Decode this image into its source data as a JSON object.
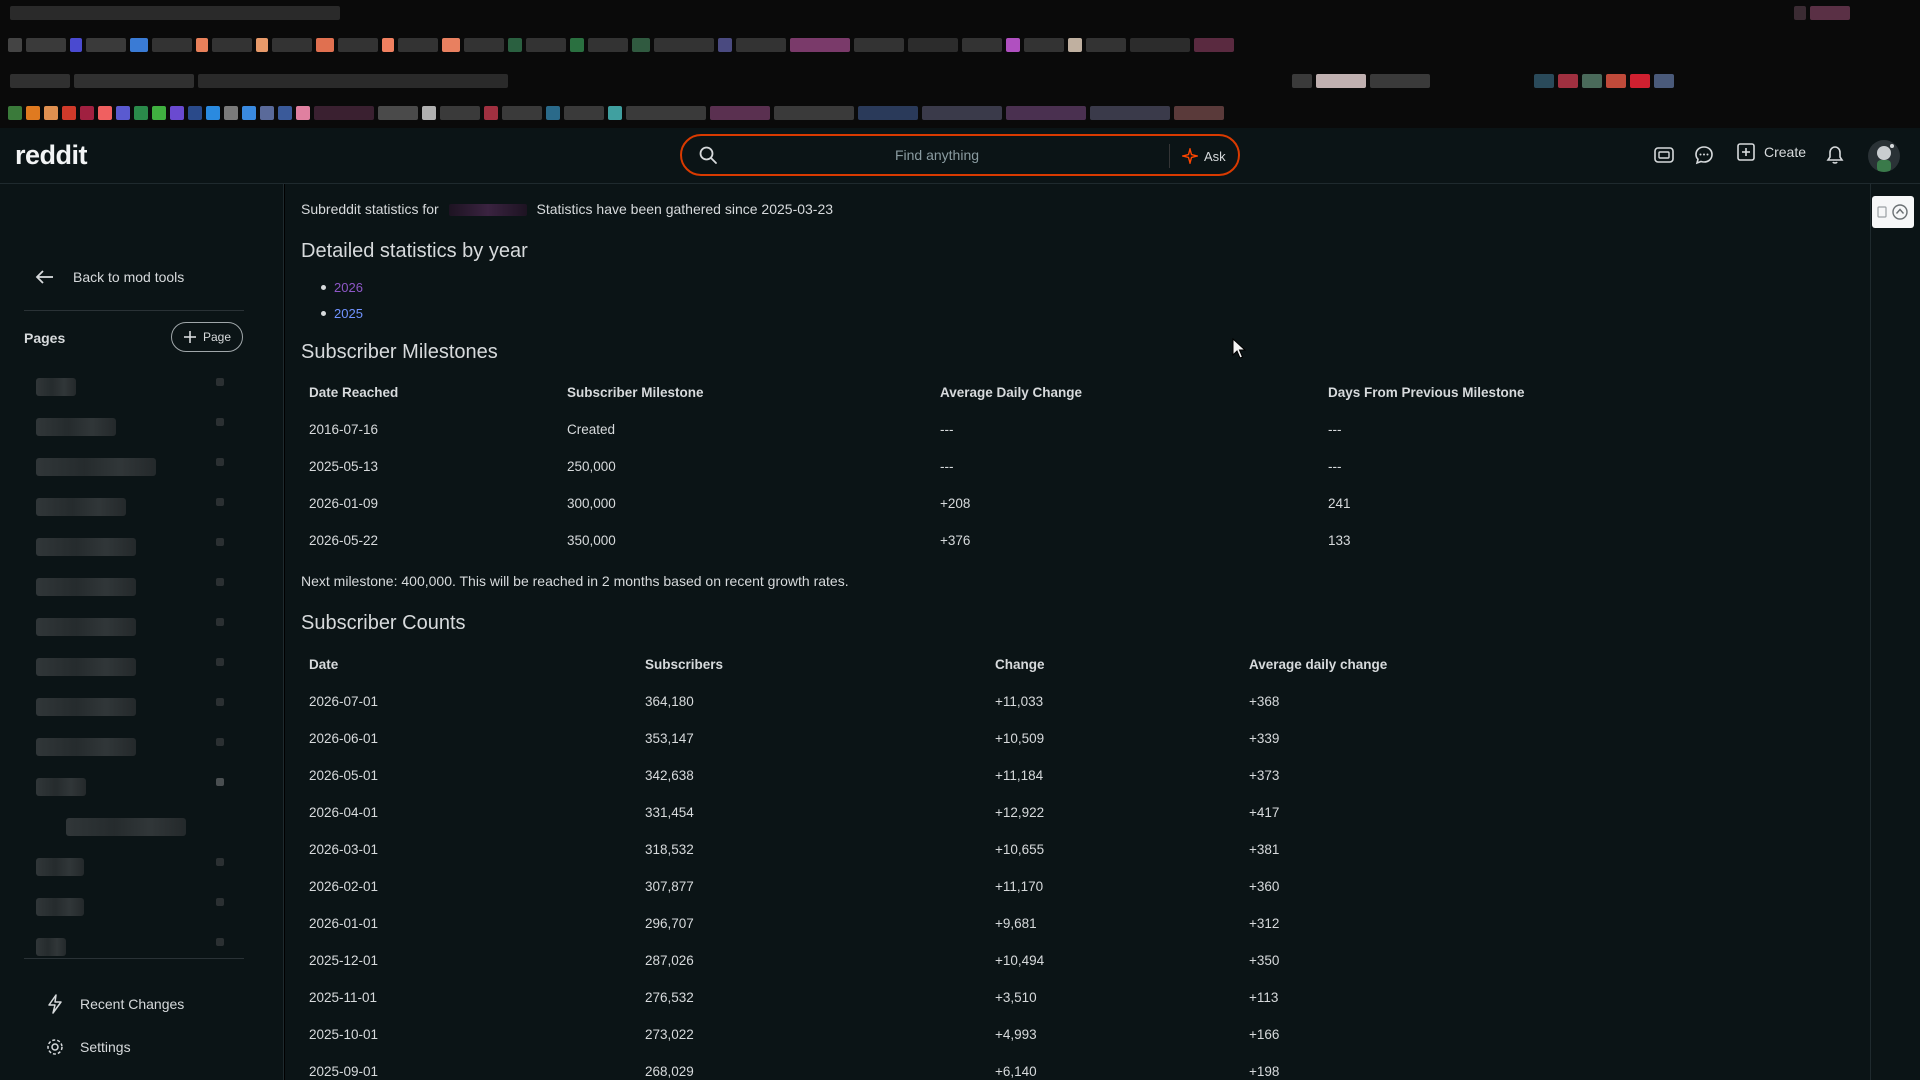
{
  "header": {
    "logo": "reddit",
    "search_placeholder": "Find anything",
    "ask_label": "Ask",
    "create_label": "Create"
  },
  "sidebar": {
    "back_label": "Back to mod tools",
    "pages_label": "Pages",
    "add_page_label": "Page",
    "recent_changes_label": "Recent Changes",
    "settings_label": "Settings"
  },
  "main": {
    "intro_prefix": "Subreddit statistics for",
    "intro_suffix": "Statistics have been gathered since 2025-03-23",
    "years_heading": "Detailed statistics by year",
    "years": [
      "2026",
      "2025"
    ],
    "milestones_heading": "Subscriber Milestones",
    "milestones_columns": [
      "Date Reached",
      "Subscriber Milestone",
      "Average Daily Change",
      "Days From Previous Milestone"
    ],
    "milestones_rows": [
      [
        "2016-07-16",
        "Created",
        "---",
        "---"
      ],
      [
        "2025-05-13",
        "250,000",
        "---",
        "---"
      ],
      [
        "2026-01-09",
        "300,000",
        "+208",
        "241"
      ],
      [
        "2026-05-22",
        "350,000",
        "+376",
        "133"
      ]
    ],
    "next_milestone": "Next milestone: 400,000. This will be reached in 2 months based on recent growth rates.",
    "counts_heading": "Subscriber Counts",
    "counts_columns": [
      "Date",
      "Subscribers",
      "Change",
      "Average daily change"
    ],
    "counts_rows": [
      [
        "2026-07-01",
        "364,180",
        "+11,033",
        "+368"
      ],
      [
        "2026-06-01",
        "353,147",
        "+10,509",
        "+339"
      ],
      [
        "2026-05-01",
        "342,638",
        "+11,184",
        "+373"
      ],
      [
        "2026-04-01",
        "331,454",
        "+12,922",
        "+417"
      ],
      [
        "2026-03-01",
        "318,532",
        "+10,655",
        "+381"
      ],
      [
        "2026-02-01",
        "307,877",
        "+11,170",
        "+360"
      ],
      [
        "2026-01-01",
        "296,707",
        "+9,681",
        "+312"
      ],
      [
        "2025-12-01",
        "287,026",
        "+10,494",
        "+350"
      ],
      [
        "2025-11-01",
        "276,532",
        "+3,510",
        "+113"
      ],
      [
        "2025-10-01",
        "273,022",
        "+4,993",
        "+166"
      ],
      [
        "2025-09-01",
        "268,029",
        "+6,140",
        "+198"
      ]
    ]
  },
  "colors": {
    "accent_search_border": "#d93a00",
    "link": "#7193ff",
    "link_visited": "#8e57c7",
    "background": "#0b1416"
  }
}
